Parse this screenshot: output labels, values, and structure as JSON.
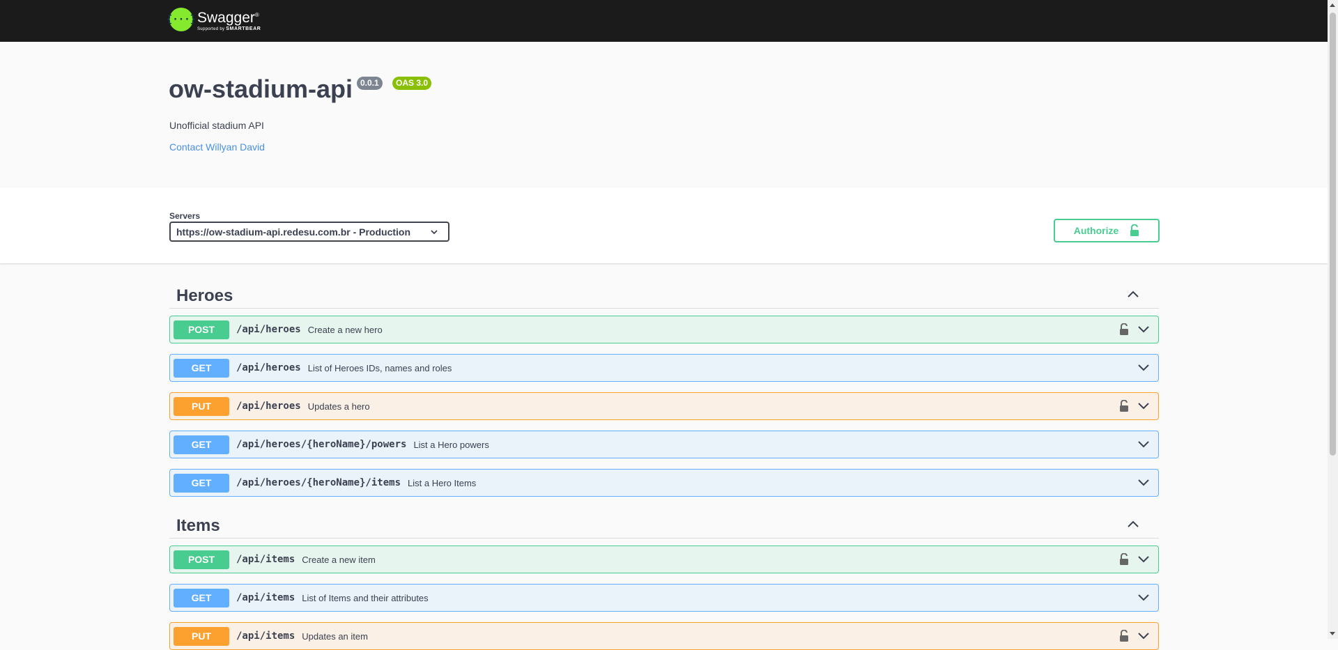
{
  "topbar": {
    "logo_symbol": "{···}",
    "logo_title": "Swagger",
    "logo_sub_prefix": "Supported by",
    "logo_sub_brand": "SMARTBEAR"
  },
  "info": {
    "title": "ow-stadium-api",
    "version": "0.0.1",
    "oas": "OAS 3.0",
    "description": "Unofficial stadium API",
    "contact": "Contact Willyan David"
  },
  "servers": {
    "label": "Servers",
    "selected": "https://ow-stadium-api.redesu.com.br - Production"
  },
  "authorize": {
    "label": "Authorize"
  },
  "tags": [
    {
      "name": "Heroes",
      "operations": [
        {
          "method": "POST",
          "path": "/api/heroes",
          "summary": "Create a new hero",
          "locked": true
        },
        {
          "method": "GET",
          "path": "/api/heroes",
          "summary": "List of Heroes IDs, names and roles",
          "locked": false
        },
        {
          "method": "PUT",
          "path": "/api/heroes",
          "summary": "Updates a hero",
          "locked": true
        },
        {
          "method": "GET",
          "path": "/api/heroes/{heroName}/powers",
          "summary": "List a Hero powers",
          "locked": false
        },
        {
          "method": "GET",
          "path": "/api/heroes/{heroName}/items",
          "summary": "List a Hero Items",
          "locked": false
        }
      ]
    },
    {
      "name": "Items",
      "operations": [
        {
          "method": "POST",
          "path": "/api/items",
          "summary": "Create a new item",
          "locked": true
        },
        {
          "method": "GET",
          "path": "/api/items",
          "summary": "List of Items and their attributes",
          "locked": false
        },
        {
          "method": "PUT",
          "path": "/api/items",
          "summary": "Updates an item",
          "locked": true
        }
      ]
    }
  ],
  "colors": {
    "post": "#49cc90",
    "get": "#61affe",
    "put": "#fca130",
    "link": "#4990e2",
    "topbar": "#1b1b1b"
  }
}
